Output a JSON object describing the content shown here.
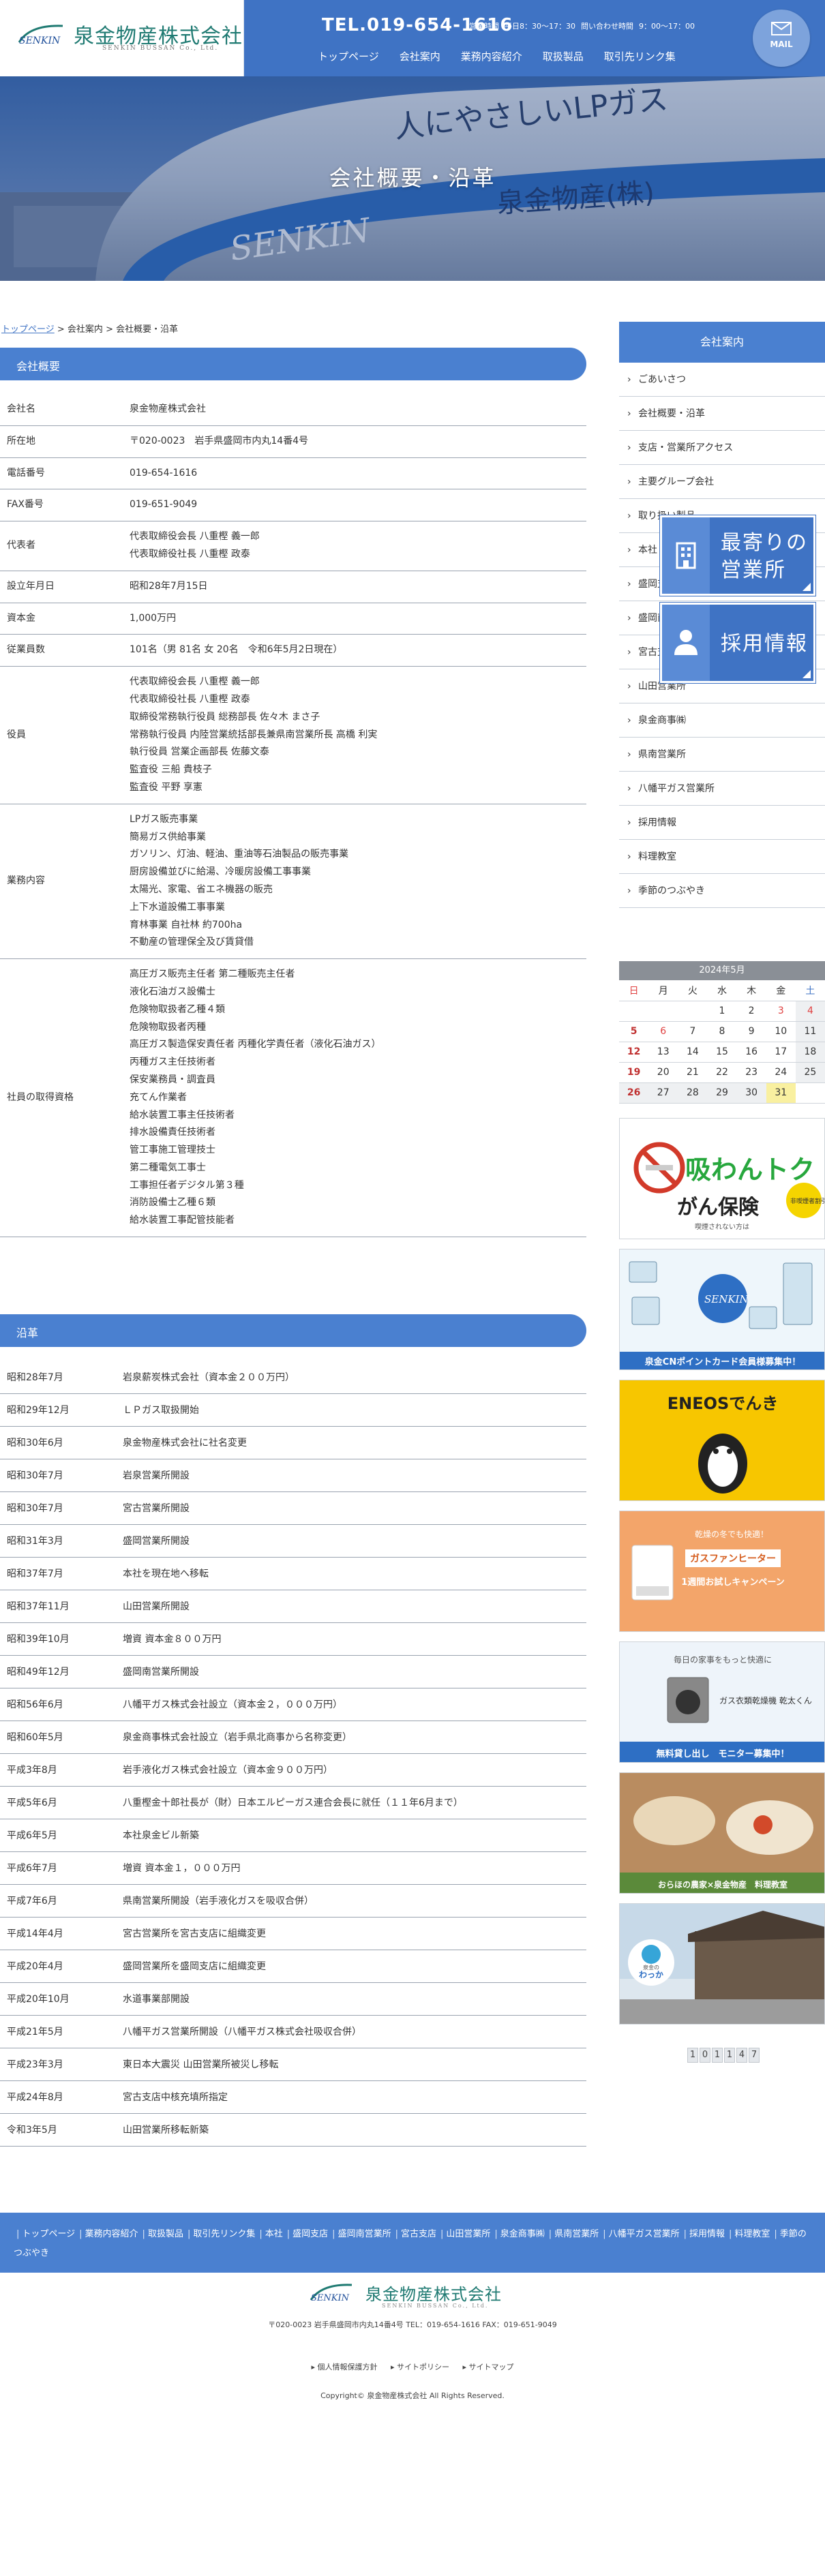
{
  "header": {
    "company_name": "泉金物産株式会社",
    "company_name_en": "SENKIN BUSSAN Co., Ltd.",
    "logo_text": "SENKIN",
    "tel": "TEL.019-654-1616",
    "hours_label": "営業時間",
    "hours_value": "平日8：30〜17：30",
    "inquiry_label": "問い合わせ時間",
    "inquiry_value": "9：00〜17：00",
    "mail_label": "MAIL",
    "nav": [
      "トップページ",
      "会社案内",
      "業務内容紹介",
      "取扱製品",
      "取引先リンク集"
    ]
  },
  "hero": {
    "title": "会社概要・沿革",
    "tank_text": "人にやさしいLPガス",
    "tank_company": "泉金物産(株)",
    "tank_logo": "SENKIN"
  },
  "breadcrumb": {
    "top": "トップページ",
    "sep": " > ",
    "parent": "会社案内",
    "current": "会社概要・沿革"
  },
  "overview": {
    "heading": "会社概要",
    "rows": [
      {
        "k": "会社名",
        "v": [
          "泉金物産株式会社"
        ]
      },
      {
        "k": "所在地",
        "v": [
          "〒020-0023　岩手県盛岡市内丸14番4号"
        ]
      },
      {
        "k": "電話番号",
        "v": [
          "019-654-1616"
        ]
      },
      {
        "k": "FAX番号",
        "v": [
          "019-651-9049"
        ]
      },
      {
        "k": "代表者",
        "v": [
          "代表取締役会長 八重樫 義一郎",
          "代表取締役社長 八重樫 政泰"
        ]
      },
      {
        "k": "設立年月日",
        "v": [
          "昭和28年7月15日"
        ]
      },
      {
        "k": "資本金",
        "v": [
          "1,000万円"
        ]
      },
      {
        "k": "従業員数",
        "v": [
          "101名（男 81名 女 20名　令和6年5月2日現在）"
        ]
      },
      {
        "k": "役員",
        "v": [
          "代表取締役会長 八重樫 義一郎",
          "代表取締役社長 八重樫 政泰",
          "取締役常務執行役員 総務部長 佐々木 まさ子",
          "常務執行役員 内陸営業統括部長兼県南営業所長 高橋 利実",
          "執行役員 営業企画部長 佐藤文泰",
          "監査役 三船 貴枝子",
          "監査役 平野 享憲"
        ]
      },
      {
        "k": "業務内容",
        "v": [
          "LPガス販売事業",
          "簡易ガス供給事業",
          "ガソリン、灯油、軽油、重油等石油製品の販売事業",
          "厨房設備並びに給湯、冷暖房設備工事事業",
          "太陽光、家電、省エネ機器の販売",
          "上下水道設備工事事業",
          "育林事業 自社林 約700ha",
          "不動産の管理保全及び賃貸借"
        ]
      },
      {
        "k": "社員の取得資格",
        "v": [
          "高圧ガス販売主任者 第二種販売主任者",
          "液化石油ガス設備士",
          "危険物取扱者乙種４類",
          "危険物取扱者丙種",
          "高圧ガス製造保安責任者 丙種化学責任者（液化石油ガス）",
          "丙種ガス主任技術者",
          "保安業務員・調査員",
          "充てん作業者",
          "給水装置工事主任技術者",
          "排水設備責任技術者",
          "管工事施工管理技士",
          "第二種電気工事士",
          "工事担任者デジタル第３種",
          "消防設備士乙種６類",
          "給水装置工事配管技能者"
        ]
      }
    ]
  },
  "history": {
    "heading": "沿革",
    "rows": [
      {
        "k": "昭和28年7月",
        "v": "岩泉薪炭株式会社（資本金２００万円）"
      },
      {
        "k": "昭和29年12月",
        "v": "ＬＰガス取扱開始"
      },
      {
        "k": "昭和30年6月",
        "v": "泉金物産株式会社に社名変更"
      },
      {
        "k": "昭和30年7月",
        "v": "岩泉営業所開設"
      },
      {
        "k": "昭和30年7月",
        "v": "宮古営業所開設"
      },
      {
        "k": "昭和31年3月",
        "v": "盛岡営業所開設"
      },
      {
        "k": "昭和37年7月",
        "v": "本社を現在地へ移転"
      },
      {
        "k": "昭和37年11月",
        "v": "山田営業所開設"
      },
      {
        "k": "昭和39年10月",
        "v": "増資 資本金８００万円"
      },
      {
        "k": "昭和49年12月",
        "v": "盛岡南営業所開設"
      },
      {
        "k": "昭和56年6月",
        "v": "八幡平ガス株式会社設立（資本金２，０００万円）"
      },
      {
        "k": "昭和60年5月",
        "v": "泉金商事株式会社設立（岩手県北商事から名称変更）"
      },
      {
        "k": "平成3年8月",
        "v": "岩手液化ガス株式会社設立（資本金９００万円）"
      },
      {
        "k": "平成5年6月",
        "v": "八重樫金十郎社長が（財）日本エルピーガス連合会長に就任（１１年6月まで）"
      },
      {
        "k": "平成6年5月",
        "v": "本社泉金ビル新築"
      },
      {
        "k": "平成6年7月",
        "v": "増資 資本金１，０００万円"
      },
      {
        "k": "平成7年6月",
        "v": "県南営業所開設（岩手液化ガスを吸収合併）"
      },
      {
        "k": "平成14年4月",
        "v": "宮古営業所を宮古支店に組織変更"
      },
      {
        "k": "平成20年4月",
        "v": "盛岡営業所を盛岡支店に組織変更"
      },
      {
        "k": "平成20年10月",
        "v": "水道事業部開設"
      },
      {
        "k": "平成21年5月",
        "v": "八幡平ガス営業所開設（八幡平ガス株式会社吸収合併）"
      },
      {
        "k": "平成23年3月",
        "v": "東日本大震災 山田営業所被災し移転"
      },
      {
        "k": "平成24年8月",
        "v": "宮古支店中核充填所指定"
      },
      {
        "k": "令和3年5月",
        "v": "山田営業所移転新築"
      }
    ]
  },
  "sidebar": {
    "heading": "会社案内",
    "items": [
      "ごあいさつ",
      "会社概要・沿革",
      "支店・営業所アクセス",
      "主要グループ会社",
      "取り扱い製品",
      "本社",
      "盛岡支店",
      "盛岡南営業所",
      "宮古支店",
      "山田営業所",
      "泉金商事㈱",
      "県南営業所",
      "八幡平ガス営業所",
      "採用情報",
      "料理教室",
      "季節のつぶやき"
    ],
    "float_banner_1": [
      "最寄りの",
      "営業所"
    ],
    "float_banner_2": "採用情報"
  },
  "calendar": {
    "title": "2024年5月",
    "weekdays": [
      "日",
      "月",
      "火",
      "水",
      "木",
      "金",
      "土"
    ],
    "weeks": [
      [
        "",
        "",
        "",
        "1",
        "2",
        "3",
        "4"
      ],
      [
        "5",
        "6",
        "7",
        "8",
        "9",
        "10",
        "11"
      ],
      [
        "12",
        "13",
        "14",
        "15",
        "16",
        "17",
        "18"
      ],
      [
        "19",
        "20",
        "21",
        "22",
        "23",
        "24",
        "25"
      ],
      [
        "26",
        "27",
        "28",
        "29",
        "30",
        "31",
        ""
      ]
    ]
  },
  "banners": {
    "b1_main": "吸わんトク",
    "b1_sub": "がん保険",
    "b1_small": "非喫煙者割引",
    "b1_tag": "喫煙されない方は",
    "b2_brand": "SENKIN",
    "b2_caption": "泉金CNポイントカード会員様募集中！",
    "b3_brand": "ENEOSでんき",
    "b4_text1": "乾燥の冬でも快適！",
    "b4_text2": "ガスファンヒーター",
    "b4_text3": "1週間お試しキャンペーン",
    "b5_text": "毎日の家事をもっと快適に",
    "b5_product": "ガス衣類乾燥機 乾太くん",
    "b5_caption": "無料貸し出し　モニター募集中！",
    "b6_caption": "おらほの農家×泉金物産　料理教室",
    "b7_label": "わっか",
    "b7_sub": "泉金の"
  },
  "counter": [
    "1",
    "0",
    "1",
    "1",
    "4",
    "7"
  ],
  "footer": {
    "nav": [
      "トップページ",
      "業務内容紹介",
      "取扱製品",
      "取引先リンク集",
      "本社",
      "盛岡支店",
      "盛岡南営業所",
      "宮古支店",
      "山田営業所",
      "泉金商事㈱",
      "県南営業所",
      "八幡平ガス営業所",
      "採用情報",
      "料理教室",
      "季節のつぶやき"
    ],
    "company_name": "泉金物産株式会社",
    "company_name_en": "SENKIN BUSSAN Co., Ltd.",
    "address": "〒020-0023 岩手県盛岡市内丸14番4号 TEL：019-654-1616  FAX：019-651-9049",
    "links": [
      "個人情報保護方針",
      "サイトポリシー",
      "サイトマップ"
    ],
    "copyright": "Copyright© 泉金物産株式会社 All Rights Reserved."
  },
  "colors": {
    "brand_blue": "#3f73c4",
    "heading_blue": "#4a80d0",
    "logo_green": "#1f7a72"
  }
}
